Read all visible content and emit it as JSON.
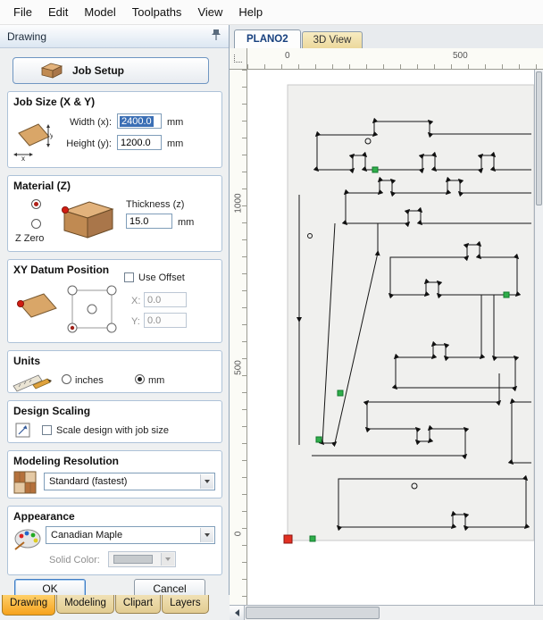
{
  "menu": {
    "items": [
      "File",
      "Edit",
      "Model",
      "Toolpaths",
      "View",
      "Help"
    ]
  },
  "panel": {
    "title": "Drawing",
    "job_setup": {
      "label": "Job Setup"
    },
    "job_size": {
      "title": "Job Size (X & Y)",
      "width_label": "Width (x):",
      "width_value": "2400.0",
      "height_label": "Height (y):",
      "height_value": "1200.0",
      "unit": "mm"
    },
    "material": {
      "title": "Material (Z)",
      "z_zero_label": "Z Zero",
      "thickness_label": "Thickness (z)",
      "thickness_value": "15.0",
      "unit": "mm"
    },
    "datum": {
      "title": "XY Datum Position",
      "use_offset_label": "Use Offset",
      "x_label": "X:",
      "x_value": "0.0",
      "y_label": "Y:",
      "y_value": "0.0"
    },
    "units": {
      "title": "Units",
      "inches_label": "inches",
      "mm_label": "mm"
    },
    "design_scaling": {
      "title": "Design Scaling",
      "checkbox_label": "Scale design with job size"
    },
    "modeling_resolution": {
      "title": "Modeling Resolution",
      "value": "Standard (fastest)"
    },
    "appearance": {
      "title": "Appearance",
      "value": "Canadian Maple",
      "solid_color_label": "Solid Color:"
    },
    "buttons": {
      "ok": "OK",
      "cancel": "Cancel"
    },
    "tabs": [
      "Drawing",
      "Modeling",
      "Clipart",
      "Layers"
    ]
  },
  "view": {
    "tabs": [
      "PLANO2",
      "3D View"
    ],
    "h_ruler_labels": [
      "0",
      "500"
    ],
    "v_ruler_labels": [
      "1000",
      "500",
      "0"
    ]
  },
  "icons": {
    "axis_x": "x",
    "axis_y": "y",
    "pin": "thumbtack",
    "wood_block": "wood-material-block",
    "palette": "color-palette",
    "ruler_pencil": "ruler-and-pencil",
    "resolution_grid": "checker-grid",
    "scale_box": "scale-arrow-box"
  },
  "colors": {
    "accent_tab_active": "#f6a21d",
    "selection_highlight": "#3b6fb5",
    "origin_marker": "#e23022",
    "node_marker": "#2fae4a",
    "wood": "#d9a668"
  }
}
